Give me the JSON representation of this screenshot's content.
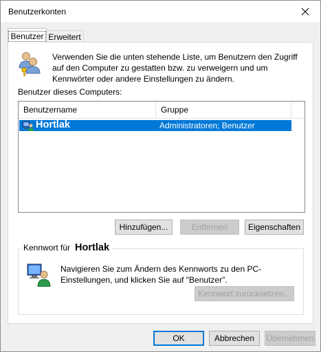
{
  "window": {
    "title": "Benutzerkonten"
  },
  "tabs": [
    {
      "label": "Benutzer",
      "active": true
    },
    {
      "label": "Erweitert",
      "active": false
    }
  ],
  "intro_text": "Verwenden Sie die unten stehende Liste, um Benutzern den Zugriff auf den Computer zu gestatten bzw. zu verweigern und um Kennwörter oder andere Einstellungen zu ändern.",
  "users_list": {
    "heading": "Benutzer dieses Computers:",
    "columns": [
      "Benutzername",
      "Gruppe"
    ],
    "rows": [
      {
        "name": "Hortlak",
        "group": "Administratoren; Benutzer",
        "selected": true
      }
    ]
  },
  "list_buttons": {
    "add": "Hinzufügen...",
    "remove": "Entfernen",
    "properties": "Eigenschaften"
  },
  "password": {
    "legend_prefix": "Kennwort für",
    "user": "Hortlak",
    "text": "Navigieren Sie zum Ändern des Kennworts zu den PC-Einstellungen, und klicken Sie auf \"Benutzer\".",
    "reset_button": "Kennwort zurücksetzen..."
  },
  "dialog_buttons": {
    "ok": "OK",
    "cancel": "Abbrechen",
    "apply": "Übernehmen"
  },
  "colors": {
    "selection": "#0078d7",
    "dialog_bg": "#f0f0f0",
    "disabled_text": "#a0a0a0"
  },
  "icons": [
    "close-icon",
    "users-icon",
    "user-computer-icon",
    "computer-user-icon"
  ]
}
